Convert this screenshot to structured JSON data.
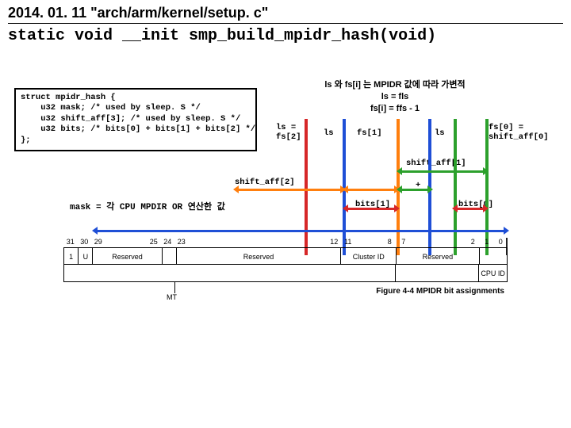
{
  "header": {
    "line1": "2014. 01. 11 \"arch/arm/kernel/setup. c\"",
    "line2": "static void __init smp_build_mpidr_hash(void)"
  },
  "struct_code": "struct mpidr_hash {\n    u32 mask; /* used by sleep. S */\n    u32 shift_aff[3]; /* used by sleep. S */\n    u32 bits; /* bits[0] + bits[1] + bits[2] */\n};",
  "note_top": "ls 와 fs[i] 는 MPIDR 값에 따라 가변적\nls = fls\nfs[i] = ffs - 1",
  "mask_note": "mask = 각 CPU MPDIR OR 연산한 값",
  "labels": {
    "ls_fs2": "ls =\nfs[2]",
    "ls1": "ls",
    "fs1": "fs[1]",
    "ls2": "ls",
    "fs0_shift0": "fs[0] =\nshift_aff[0]",
    "shift_aff1": "shift_aff[1]",
    "shift_aff2": "shift_aff[2]",
    "plus": "+",
    "bits1": "bits[1]",
    "bits0": "bits[0]"
  },
  "chart_data": {
    "type": "table",
    "title": "Figure 4-4 MPIDR bit assignments",
    "bitnums": [
      "31",
      "30",
      "29",
      "25",
      "24",
      "23",
      "12",
      "11",
      "8",
      "7",
      "2",
      "1",
      "0"
    ],
    "row1": [
      {
        "label": "1",
        "bits": 1
      },
      {
        "label": "U",
        "bits": 1
      },
      {
        "label": "Reserved",
        "bits": 5
      },
      {
        "label": "",
        "bits": 1
      },
      {
        "label": "Reserved",
        "bits": 12
      },
      {
        "label": "Cluster ID",
        "bits": 4
      },
      {
        "label": "Reserved",
        "bits": 6
      },
      {
        "label": "",
        "bits": 2
      }
    ],
    "row2": [
      {
        "label": "",
        "bits": 24
      },
      {
        "label": "",
        "bits": 6
      },
      {
        "label": "CPU ID",
        "bits": 2
      }
    ],
    "mt_label": "MT"
  }
}
